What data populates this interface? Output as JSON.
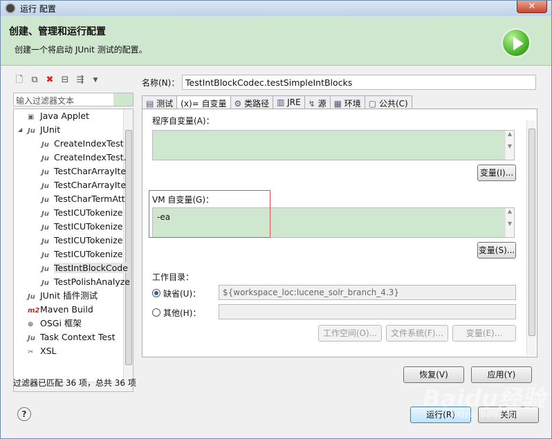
{
  "window": {
    "title": "运行 配置",
    "close": "✕"
  },
  "header": {
    "title": "创建、管理和运行配置",
    "subtitle": "创建一个将启动 JUnit 测试的配置。"
  },
  "left": {
    "filter_placeholder": "输入过滤器文本",
    "tree": [
      {
        "label": "Java Applet",
        "icon": "▣",
        "indent": 0
      },
      {
        "label": "JUnit",
        "icon": "Ju",
        "indent": 0,
        "expander": "◢"
      },
      {
        "label": "CreateIndexTest",
        "icon": "Ju",
        "indent": 1
      },
      {
        "label": "CreateIndexTest.",
        "icon": "Ju",
        "indent": 1
      },
      {
        "label": "TestCharArrayIte",
        "icon": "Ju",
        "indent": 1
      },
      {
        "label": "TestCharArrayIte",
        "icon": "Ju",
        "indent": 1
      },
      {
        "label": "TestCharTermAtt",
        "icon": "Ju",
        "indent": 1
      },
      {
        "label": "TestICUTokenize",
        "icon": "Ju",
        "indent": 1
      },
      {
        "label": "TestICUTokenize",
        "icon": "Ju",
        "indent": 1
      },
      {
        "label": "TestICUTokenize",
        "icon": "Ju",
        "indent": 1
      },
      {
        "label": "TestICUTokenize",
        "icon": "Ju",
        "indent": 1
      },
      {
        "label": "TestIntBlockCode",
        "icon": "Ju",
        "indent": 1,
        "selected": true
      },
      {
        "label": "TestPolishAnalyze",
        "icon": "Ju",
        "indent": 1
      },
      {
        "label": "JUnit 插件测试",
        "icon": "Ju",
        "indent": 0
      },
      {
        "label": "Maven Build",
        "icon": "m2",
        "indent": 0
      },
      {
        "label": "OSGi 框架",
        "icon": "⊕",
        "indent": 0
      },
      {
        "label": "Task Context Test",
        "icon": "Ju",
        "indent": 0
      },
      {
        "label": "XSL",
        "icon": "✂",
        "indent": 0
      }
    ],
    "status": "过滤器已匹配 36 项，总共 36 项"
  },
  "right": {
    "name_label": "名称(N)：",
    "name_value": "TestIntBlockCodec.testSimpleIntBlocks",
    "tabs": [
      {
        "label": "测试",
        "icon": "▤"
      },
      {
        "label": "(x)= 自变量",
        "icon": "",
        "active": true
      },
      {
        "label": "类路径",
        "icon": "⚙"
      },
      {
        "label": "JRE",
        "icon": "▥"
      },
      {
        "label": "源",
        "icon": "↯"
      },
      {
        "label": "环境",
        "icon": "▦"
      },
      {
        "label": "公共(C)",
        "icon": "▢"
      }
    ],
    "program_args_label": "程序自变量(A)：",
    "program_args_value": "",
    "program_vars_button": "变量(I)...",
    "vm_args_label": "VM 自变量(G)：",
    "vm_args_value": "-ea",
    "vm_vars_button": "变量(S)...",
    "workdir_label": "工作目录：",
    "default_label": "缺省(U)：",
    "default_value": "${workspace_loc:lucene_solr_branch_4.3}",
    "other_label": "其他(H)：",
    "workspace_button": "工作空间(O)...",
    "filesystem_button": "文件系统(F)...",
    "variables_button": "变量(E)...",
    "restore_button": "恢复(V)",
    "apply_button": "应用(Y)"
  },
  "footer": {
    "help": "?",
    "run_button": "运行(R)",
    "close_button": "关闭"
  },
  "watermark": {
    "text": "Baidu经验",
    "sub": "jingyan.baidu.com"
  }
}
